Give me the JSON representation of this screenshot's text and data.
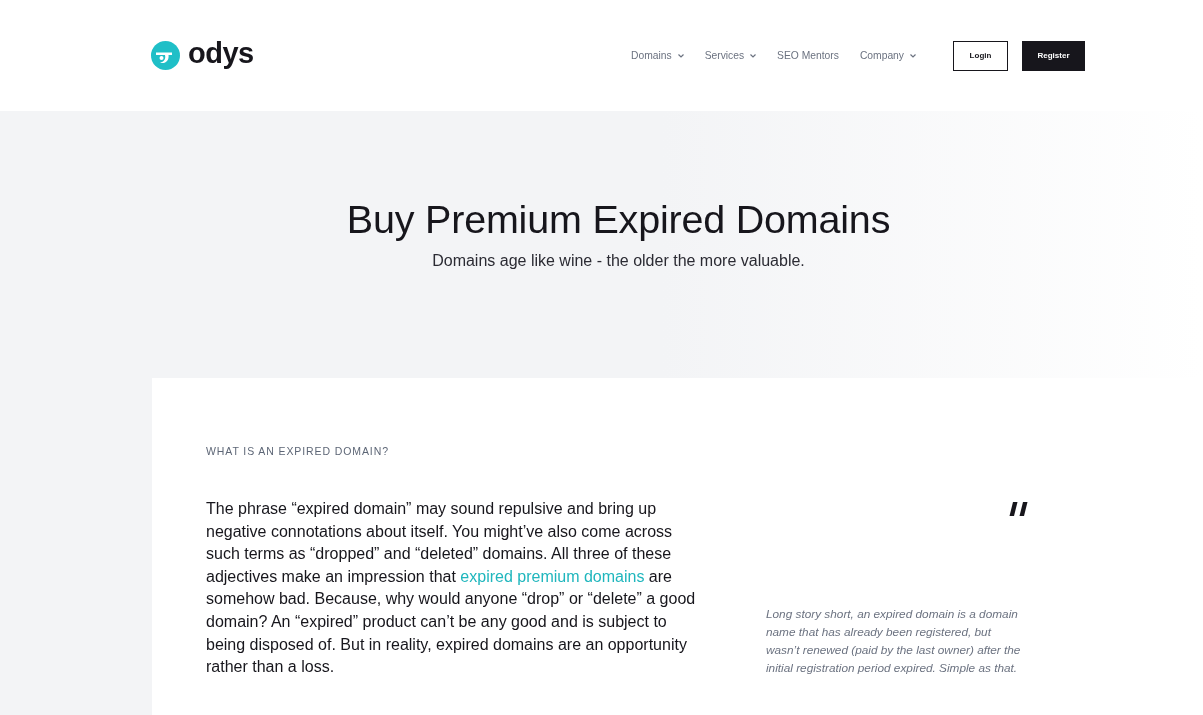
{
  "header": {
    "logo": "odys",
    "nav": [
      {
        "label": "Domains",
        "has_dropdown": true
      },
      {
        "label": "Services",
        "has_dropdown": true
      },
      {
        "label": "SEO Mentors",
        "has_dropdown": false
      },
      {
        "label": "Company",
        "has_dropdown": true
      }
    ],
    "buttons": [
      {
        "label": "Login",
        "kind": "outline"
      },
      {
        "label": "Register",
        "kind": "solid"
      }
    ]
  },
  "hero": {
    "title": "Buy Premium Expired Domains",
    "subtitle": "Domains age like wine - the older the more valuable."
  },
  "section": {
    "eyebrow": "WHAT IS AN EXPIRED DOMAIN?",
    "paragraph": [
      {
        "kind": "text",
        "text": "The phrase “expired domain” may sound repulsive and bring up negative connotations about itself. You might’ve also come across such terms as “dropped” and “deleted” domains. All three of these adjectives make an impression that "
      },
      {
        "kind": "link",
        "text": "expired premium domains"
      },
      {
        "kind": "text",
        "text": " are somehow bad. Because, why would anyone “drop” or “delete” a good domain? An “expired” product can’t be any good and is subject to being disposed of. But in reality, expired domains are an opportunity rather than a loss."
      }
    ],
    "quote": "Long story short, an expired domain is a domain name that has already been registered, but wasn’t renewed (paid by the last owner) after the initial registration period expired. Simple as that."
  }
}
